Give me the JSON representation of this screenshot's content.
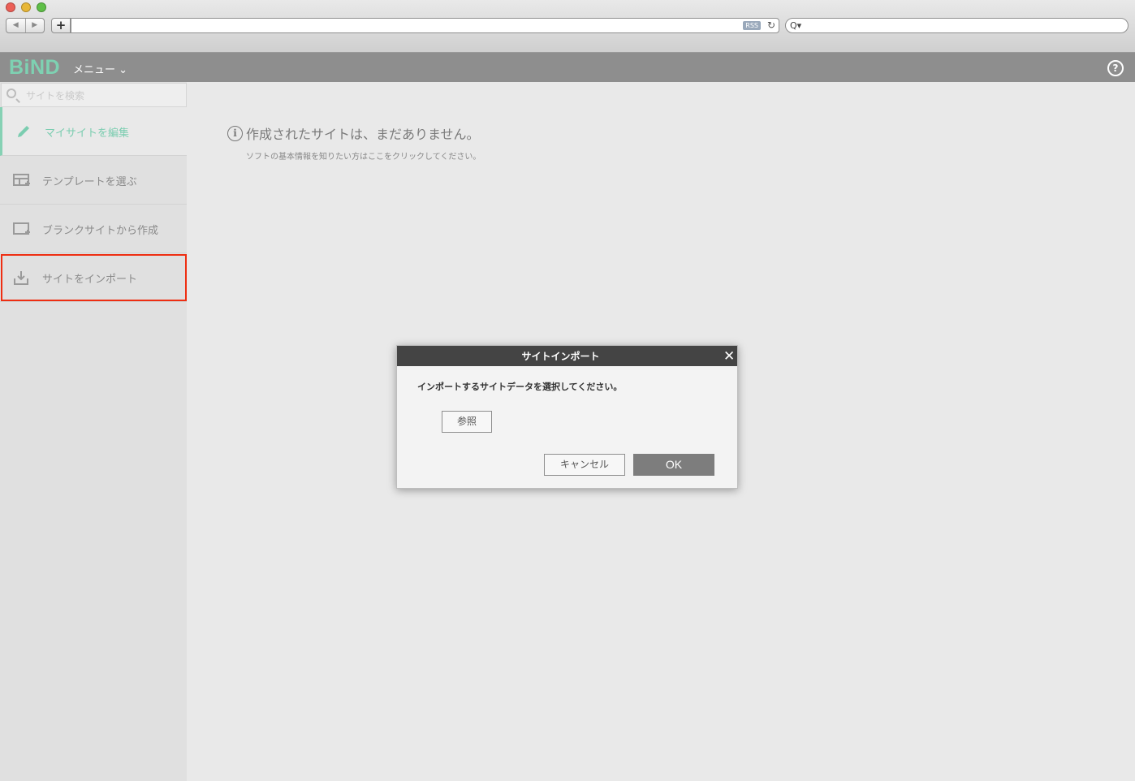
{
  "browser": {
    "back_glyph": "◀",
    "forward_glyph": "▶",
    "new_tab_glyph": "+",
    "rss_label": "RSS",
    "reload_glyph": "↻",
    "search_glyph": "Q▾"
  },
  "app": {
    "logo": "BiND",
    "menu_label": "メニュー ⌄",
    "help_glyph": "?",
    "accent_color": "#7ed1b2"
  },
  "sidebar": {
    "search_placeholder": "サイトを検索",
    "items": [
      {
        "label": "マイサイトを編集",
        "icon": "pencil-icon"
      },
      {
        "label": "テンプレートを選ぶ",
        "icon": "template-add-icon"
      },
      {
        "label": "ブランクサイトから作成",
        "icon": "blank-site-add-icon"
      },
      {
        "label": "サイトをインポート",
        "icon": "import-icon"
      }
    ]
  },
  "main": {
    "info_glyph": "i",
    "title": "作成されたサイトは、まだありません。",
    "subtitle": "ソフトの基本情報を知りたい方はここをクリックしてください。"
  },
  "dialog": {
    "title": "サイトインポート",
    "close_glyph": "✕",
    "message": "インポートするサイトデータを選択してください。",
    "browse_label": "参照",
    "cancel_label": "キャンセル",
    "ok_label": "OK"
  }
}
